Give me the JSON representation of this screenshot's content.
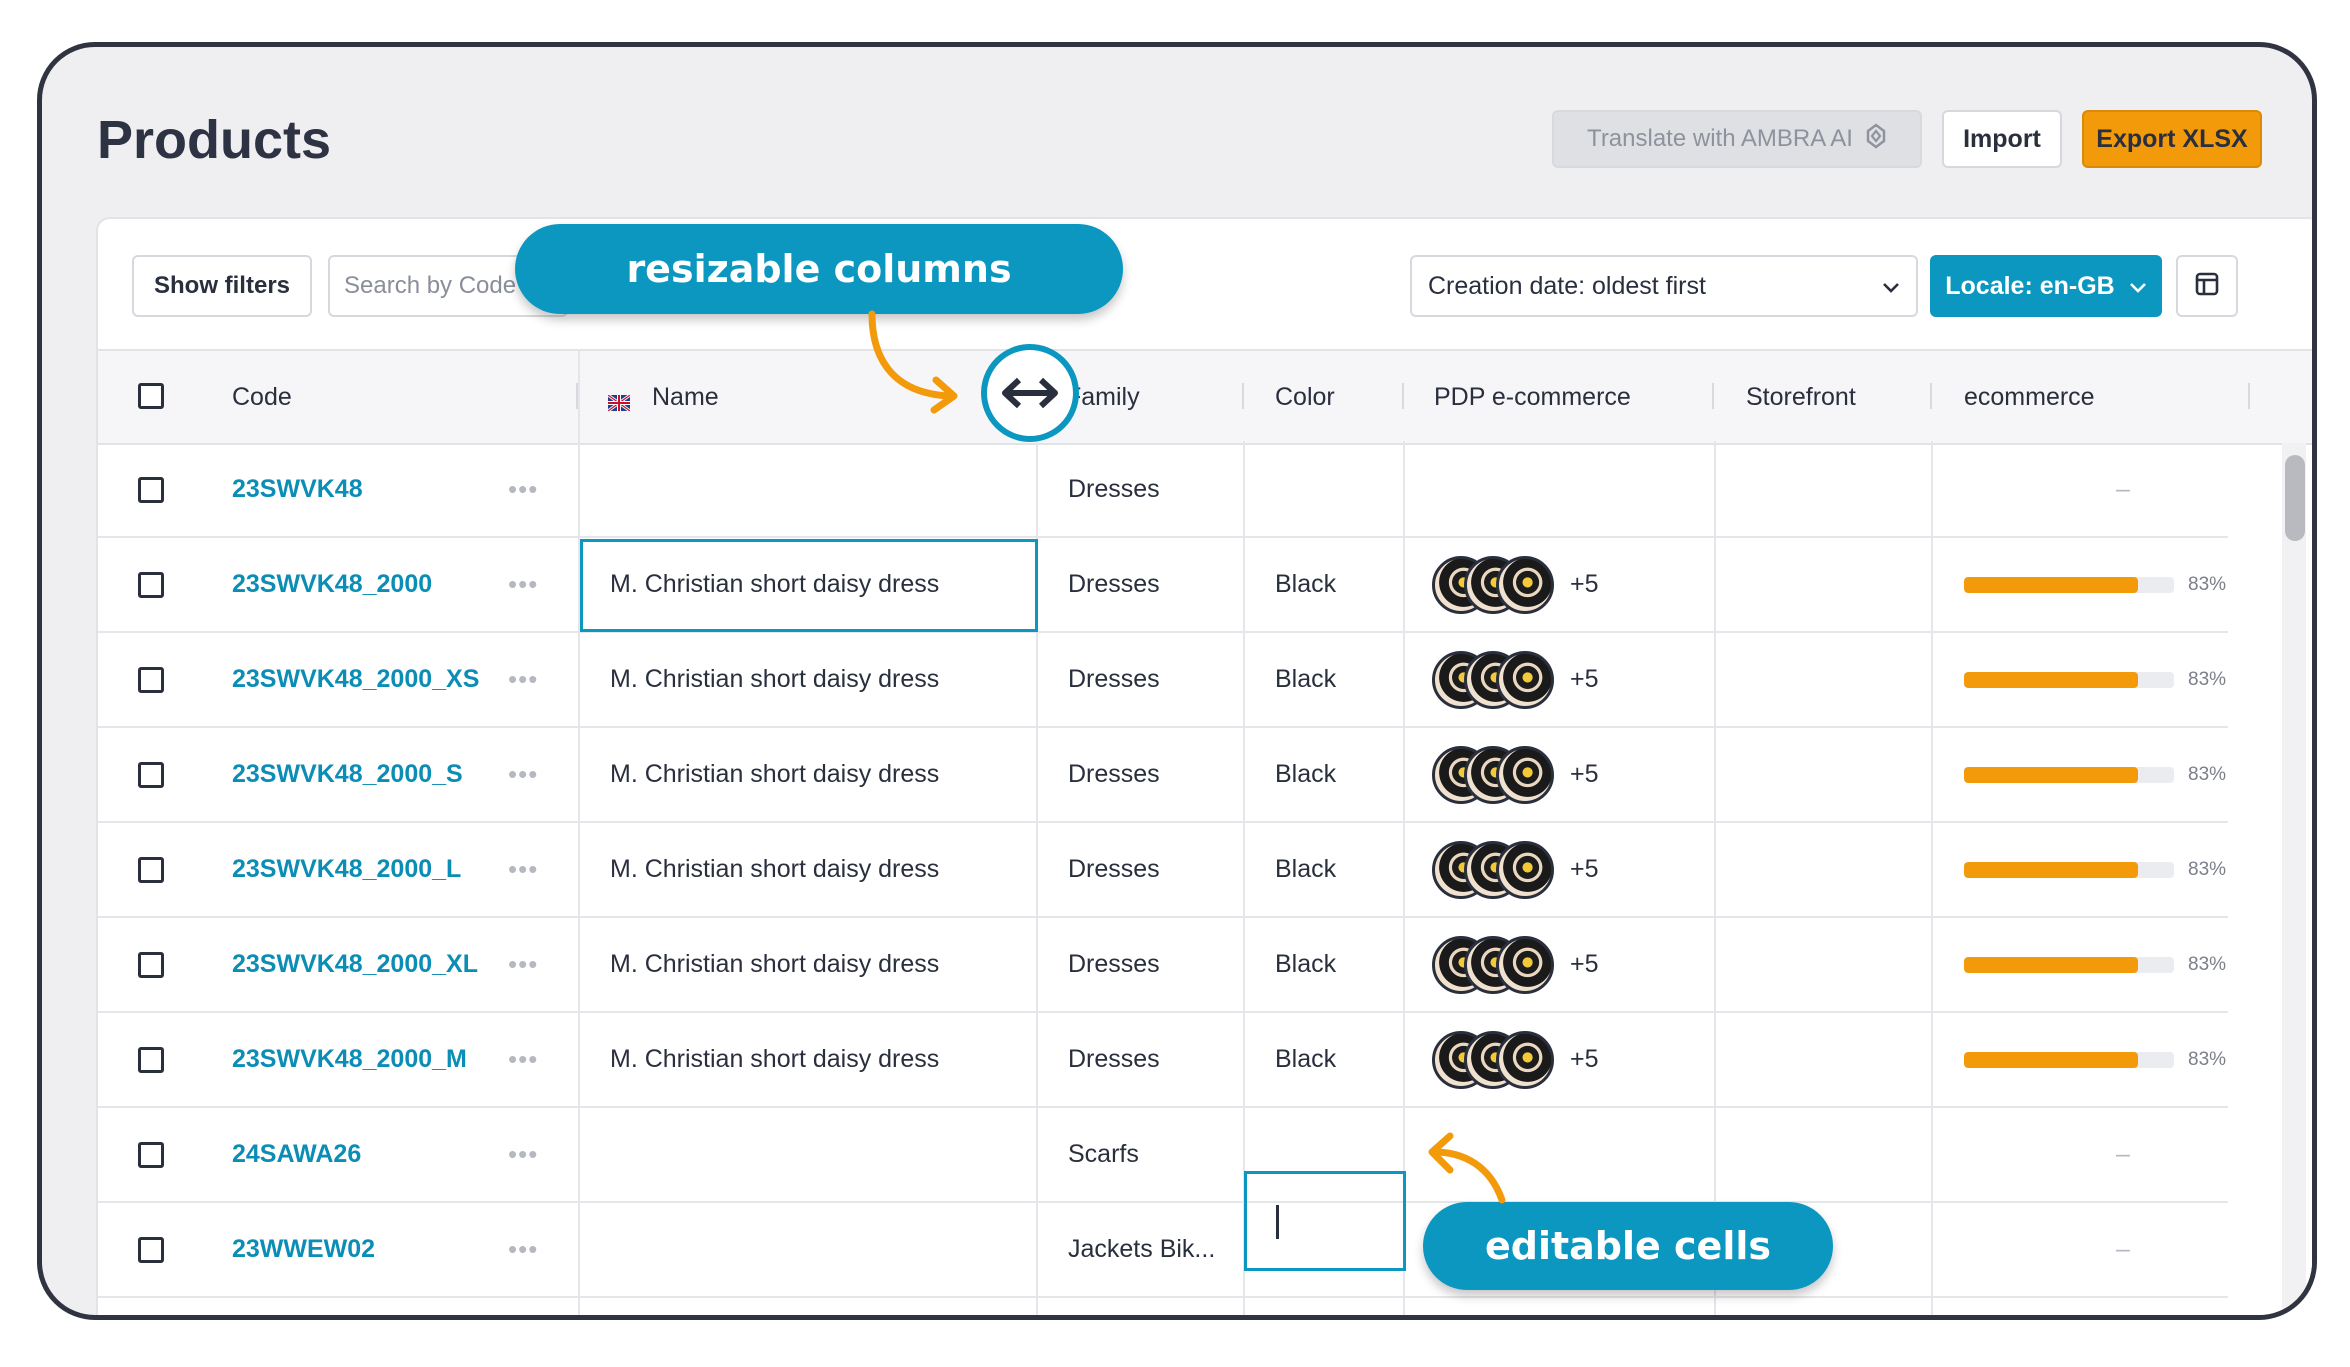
{
  "header": {
    "title": "Products",
    "translate_label": "Translate with AMBRA AI",
    "import_label": "Import",
    "export_label": "Export XLSX"
  },
  "toolbar": {
    "show_filters_label": "Show filters",
    "search_placeholder": "Search by Code",
    "sort_label": "Creation date: oldest first",
    "locale_label": "Locale: en-GB"
  },
  "table": {
    "columns": [
      "Code",
      "Name",
      "Family",
      "Color",
      "PDP e-commerce",
      "Storefront",
      "ecommerce"
    ],
    "rows": [
      {
        "code": "23SWVK48",
        "name": "",
        "family": "Dresses",
        "color": "",
        "images_more": "",
        "ecommerce_pct": null,
        "ecommerce_empty": "–"
      },
      {
        "code": "23SWVK48_2000",
        "name": "M. Christian short daisy dress",
        "family": "Dresses",
        "color": "Black",
        "images_more": "+5",
        "ecommerce_pct": 0.83,
        "ecommerce_label": "83%"
      },
      {
        "code": "23SWVK48_2000_XS",
        "name": "M. Christian short daisy dress",
        "family": "Dresses",
        "color": "Black",
        "images_more": "+5",
        "ecommerce_pct": 0.83,
        "ecommerce_label": "83%"
      },
      {
        "code": "23SWVK48_2000_S",
        "name": "M. Christian short daisy dress",
        "family": "Dresses",
        "color": "Black",
        "images_more": "+5",
        "ecommerce_pct": 0.83,
        "ecommerce_label": "83%"
      },
      {
        "code": "23SWVK48_2000_L",
        "name": "M. Christian short daisy dress",
        "family": "Dresses",
        "color": "Black",
        "images_more": "+5",
        "ecommerce_pct": 0.83,
        "ecommerce_label": "83%"
      },
      {
        "code": "23SWVK48_2000_XL",
        "name": "M. Christian short daisy dress",
        "family": "Dresses",
        "color": "Black",
        "images_more": "+5",
        "ecommerce_pct": 0.83,
        "ecommerce_label": "83%"
      },
      {
        "code": "23SWVK48_2000_M",
        "name": "M. Christian short daisy dress",
        "family": "Dresses",
        "color": "Black",
        "images_more": "+5",
        "ecommerce_pct": 0.83,
        "ecommerce_label": "83%"
      },
      {
        "code": "24SAWA26",
        "name": "",
        "family": "Scarfs",
        "color": "",
        "images_more": "",
        "ecommerce_pct": null,
        "ecommerce_empty": "–"
      },
      {
        "code": "23WWEW02",
        "name": "",
        "family": "Jackets Bik...",
        "color": "",
        "images_more": "",
        "ecommerce_pct": null,
        "ecommerce_empty": "–"
      }
    ],
    "row_menu_glyph": "•••"
  },
  "callouts": {
    "resize_label": "resizable columns",
    "edit_label": "editable cells"
  },
  "colors": {
    "accent": "#0b97c0",
    "export": "#f39a0b",
    "progress": "#f39a0b",
    "link": "#0b8db5"
  },
  "icons": {
    "translate": "ai-sparkle-icon",
    "sort_dropdown": "chevron-down-icon",
    "locale_dropdown": "chevron-down-icon",
    "columns": "columns-layout-icon",
    "flag": "uk-flag-icon",
    "resize": "resize-horizontal-icon"
  }
}
